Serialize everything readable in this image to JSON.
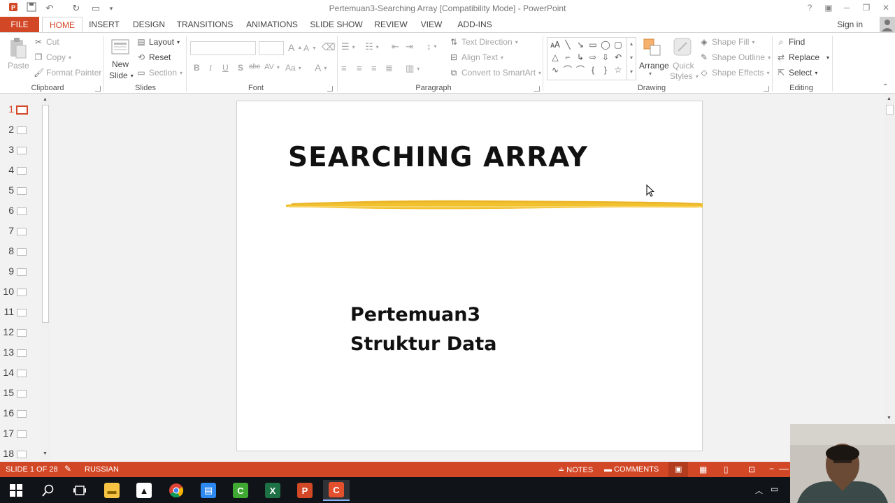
{
  "window": {
    "title": "Pertemuan3-Searching Array [Compatibility Mode] - PowerPoint",
    "sign_in": "Sign in"
  },
  "tabs": [
    {
      "label": "FILE"
    },
    {
      "label": "HOME"
    },
    {
      "label": "INSERT"
    },
    {
      "label": "DESIGN"
    },
    {
      "label": "TRANSITIONS"
    },
    {
      "label": "ANIMATIONS"
    },
    {
      "label": "SLIDE SHOW"
    },
    {
      "label": "REVIEW"
    },
    {
      "label": "VIEW"
    },
    {
      "label": "ADD-INS"
    }
  ],
  "ribbon": {
    "clipboard": {
      "paste": "Paste",
      "cut": "Cut",
      "copy": "Copy",
      "format_painter": "Format Painter",
      "label": "Clipboard"
    },
    "slides": {
      "new_slide_1": "New",
      "new_slide_2": "Slide",
      "layout": "Layout",
      "reset": "Reset",
      "section": "Section",
      "label": "Slides"
    },
    "font": {
      "label": "Font",
      "bold": "B",
      "italic": "I",
      "underline": "U",
      "shadow": "S",
      "strike": "abc",
      "spacing": "AV",
      "case": "Aa",
      "grow": "A",
      "shrink": "A"
    },
    "paragraph": {
      "label": "Paragraph",
      "text_direction": "Text Direction",
      "align_text": "Align Text",
      "convert_smartart": "Convert to SmartArt"
    },
    "drawing": {
      "label": "Drawing",
      "arrange": "Arrange",
      "quick_styles_1": "Quick",
      "quick_styles_2": "Styles",
      "shape_fill": "Shape Fill",
      "shape_outline": "Shape Outline",
      "shape_effects": "Shape Effects"
    },
    "editing": {
      "label": "Editing",
      "find": "Find",
      "replace": "Replace",
      "select": "Select"
    }
  },
  "thumbnails": [
    "1",
    "2",
    "3",
    "4",
    "5",
    "6",
    "7",
    "8",
    "9",
    "10",
    "11",
    "12",
    "13",
    "14",
    "15",
    "16",
    "17",
    "18"
  ],
  "slide": {
    "title": "SEARCHING ARRAY",
    "subtitle_line1": "Pertemuan3",
    "subtitle_line2": "Struktur Data"
  },
  "status": {
    "slide_counter": "SLIDE 1 OF 28",
    "language": "RUSSIAN",
    "notes": "NOTES",
    "comments": "COMMENTS"
  },
  "colors": {
    "accent": "#d24726",
    "highlight_stroke": "#f2c12e"
  }
}
